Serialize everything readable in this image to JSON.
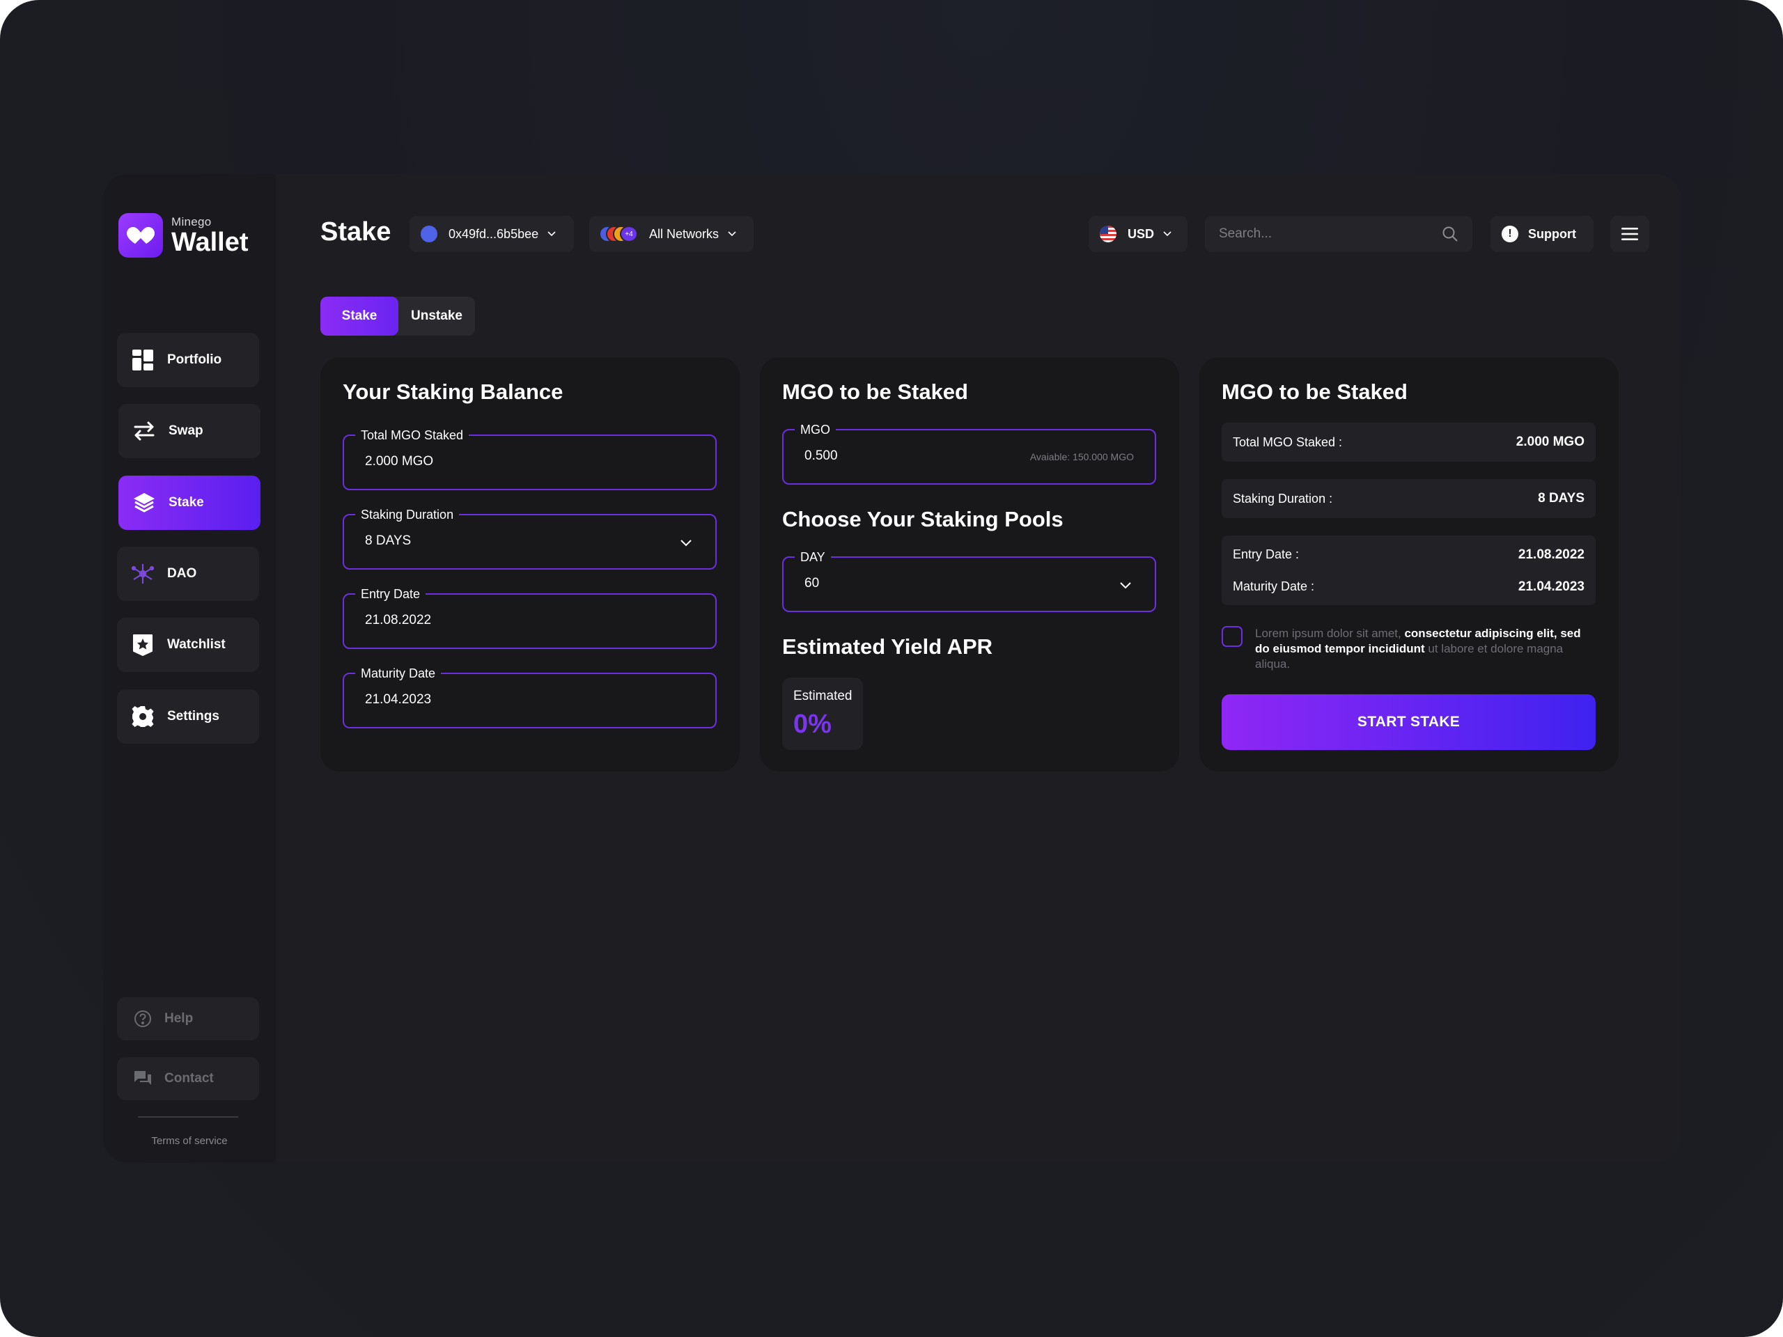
{
  "brand": {
    "small": "Minego",
    "big": "Wallet"
  },
  "nav": [
    {
      "label": "Portfolio",
      "icon": "grid-icon"
    },
    {
      "label": "Swap",
      "icon": "swap-icon"
    },
    {
      "label": "Stake",
      "icon": "layers-icon",
      "active": true
    },
    {
      "label": "DAO",
      "icon": "dao-icon"
    },
    {
      "label": "Watchlist",
      "icon": "star-badge-icon"
    },
    {
      "label": "Settings",
      "icon": "gear-icon"
    }
  ],
  "footer_nav": {
    "help": "Help",
    "contact": "Contact",
    "terms": "Terms of service"
  },
  "header": {
    "title": "Stake",
    "wallet_address": "0x49fd...6b5bee",
    "networks_label": "All Networks",
    "networks_extra": "+4",
    "currency": "USD",
    "search_placeholder": "Search...",
    "support": "Support"
  },
  "tabs": {
    "stake": "Stake",
    "unstake": "Unstake"
  },
  "balance_card": {
    "title": "Your Staking Balance",
    "fields": [
      {
        "label": "Total MGO Staked",
        "value": "2.000 MGO"
      },
      {
        "label": "Staking Duration",
        "value": "8 DAYS"
      },
      {
        "label": "Entry Date",
        "value": "21.08.2022"
      },
      {
        "label": "Maturity Date",
        "value": "21.04.2023"
      }
    ]
  },
  "stake_card": {
    "title": "MGO to be Staked",
    "amount_label": "MGO",
    "amount_value": "0.500",
    "available": "Avaiable: 150.000 MGO",
    "pools_title": "Choose Your Staking Pools",
    "pool_label": "DAY",
    "pool_value": "60",
    "yield_title": "Estimated Yield APR",
    "estimated_label": "Estimated",
    "estimated_value": "0%"
  },
  "summary_card": {
    "title": "MGO to be Staked",
    "total_label": "Total MGO Staked :",
    "total_value": "2.000 MGO",
    "duration_label": "Staking Duration :",
    "duration_value": "8 DAYS",
    "entry_label": "Entry Date :",
    "entry_value": "21.08.2022",
    "maturity_label": "Maturity Date :",
    "maturity_value": "21.04.2023",
    "terms_part1": "Lorem ipsum dolor sit amet, ",
    "terms_bold": "consectetur adipiscing elit, sed do eiusmod tempor incididunt",
    "terms_part2": " ut labore et dolore magna aliqua.",
    "button": "START STAKE"
  },
  "colors": {
    "accent": "#8a2cf4",
    "accent_blue": "#3f22f0",
    "card_bg": "#18181b"
  }
}
